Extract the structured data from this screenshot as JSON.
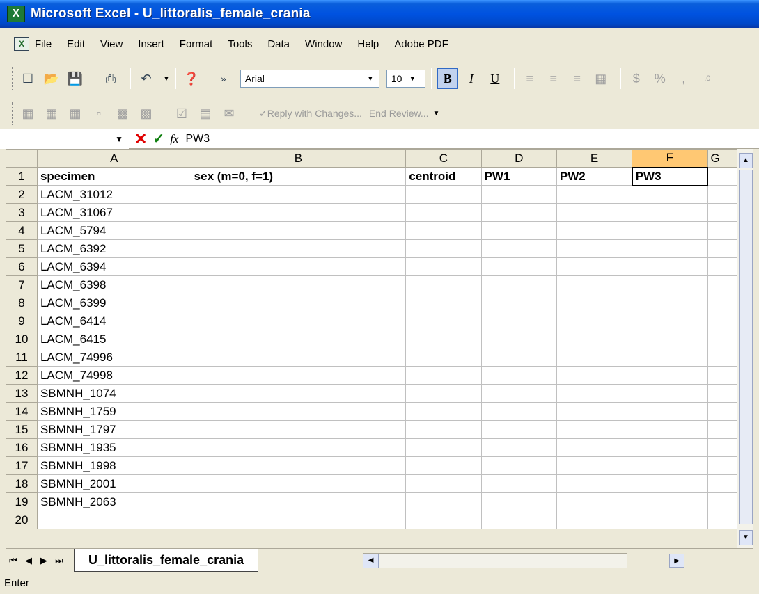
{
  "window": {
    "title": "Microsoft Excel - U_littoralis_female_crania"
  },
  "menu": [
    "File",
    "Edit",
    "View",
    "Insert",
    "Format",
    "Tools",
    "Data",
    "Window",
    "Help",
    "Adobe PDF"
  ],
  "toolbar": {
    "font_name": "Arial",
    "font_size": "10",
    "bold": "B",
    "italic": "I",
    "underline": "U",
    "currency": "$",
    "percent": "%",
    "comma": ",",
    "reply_label": "Reply with Changes...",
    "end_review_label": "End Review..."
  },
  "formula_bar": {
    "fx": "fx",
    "value": "PW3"
  },
  "columns": [
    "A",
    "B",
    "C",
    "D",
    "E",
    "F",
    "G"
  ],
  "rows": [
    {
      "num": "1",
      "cells": [
        "specimen",
        "sex (m=0, f=1)",
        "centroid",
        "PW1",
        "PW2",
        "PW3",
        ""
      ]
    },
    {
      "num": "2",
      "cells": [
        "LACM_31012",
        "",
        "",
        "",
        "",
        "",
        ""
      ]
    },
    {
      "num": "3",
      "cells": [
        "LACM_31067",
        "",
        "",
        "",
        "",
        "",
        ""
      ]
    },
    {
      "num": "4",
      "cells": [
        "LACM_5794",
        "",
        "",
        "",
        "",
        "",
        ""
      ]
    },
    {
      "num": "5",
      "cells": [
        "LACM_6392",
        "",
        "",
        "",
        "",
        "",
        ""
      ]
    },
    {
      "num": "6",
      "cells": [
        "LACM_6394",
        "",
        "",
        "",
        "",
        "",
        ""
      ]
    },
    {
      "num": "7",
      "cells": [
        "LACM_6398",
        "",
        "",
        "",
        "",
        "",
        ""
      ]
    },
    {
      "num": "8",
      "cells": [
        "LACM_6399",
        "",
        "",
        "",
        "",
        "",
        ""
      ]
    },
    {
      "num": "9",
      "cells": [
        "LACM_6414",
        "",
        "",
        "",
        "",
        "",
        ""
      ]
    },
    {
      "num": "10",
      "cells": [
        "LACM_6415",
        "",
        "",
        "",
        "",
        "",
        ""
      ]
    },
    {
      "num": "11",
      "cells": [
        "LACM_74996",
        "",
        "",
        "",
        "",
        "",
        ""
      ]
    },
    {
      "num": "12",
      "cells": [
        "LACM_74998",
        "",
        "",
        "",
        "",
        "",
        ""
      ]
    },
    {
      "num": "13",
      "cells": [
        "SBMNH_1074",
        "",
        "",
        "",
        "",
        "",
        ""
      ]
    },
    {
      "num": "14",
      "cells": [
        "SBMNH_1759",
        "",
        "",
        "",
        "",
        "",
        ""
      ]
    },
    {
      "num": "15",
      "cells": [
        "SBMNH_1797",
        "",
        "",
        "",
        "",
        "",
        ""
      ]
    },
    {
      "num": "16",
      "cells": [
        "SBMNH_1935",
        "",
        "",
        "",
        "",
        "",
        ""
      ]
    },
    {
      "num": "17",
      "cells": [
        "SBMNH_1998",
        "",
        "",
        "",
        "",
        "",
        ""
      ]
    },
    {
      "num": "18",
      "cells": [
        "SBMNH_2001",
        "",
        "",
        "",
        "",
        "",
        ""
      ]
    },
    {
      "num": "19",
      "cells": [
        "SBMNH_2063",
        "",
        "",
        "",
        "",
        "",
        ""
      ]
    },
    {
      "num": "20",
      "cells": [
        "",
        "",
        "",
        "",
        "",
        "",
        ""
      ]
    }
  ],
  "sheet_tab": "U_littoralis_female_crania",
  "status": "Enter",
  "colors": {
    "title_bar": "#0052e0",
    "selected_header": "#ffc873",
    "chrome": "#ece9d8"
  }
}
